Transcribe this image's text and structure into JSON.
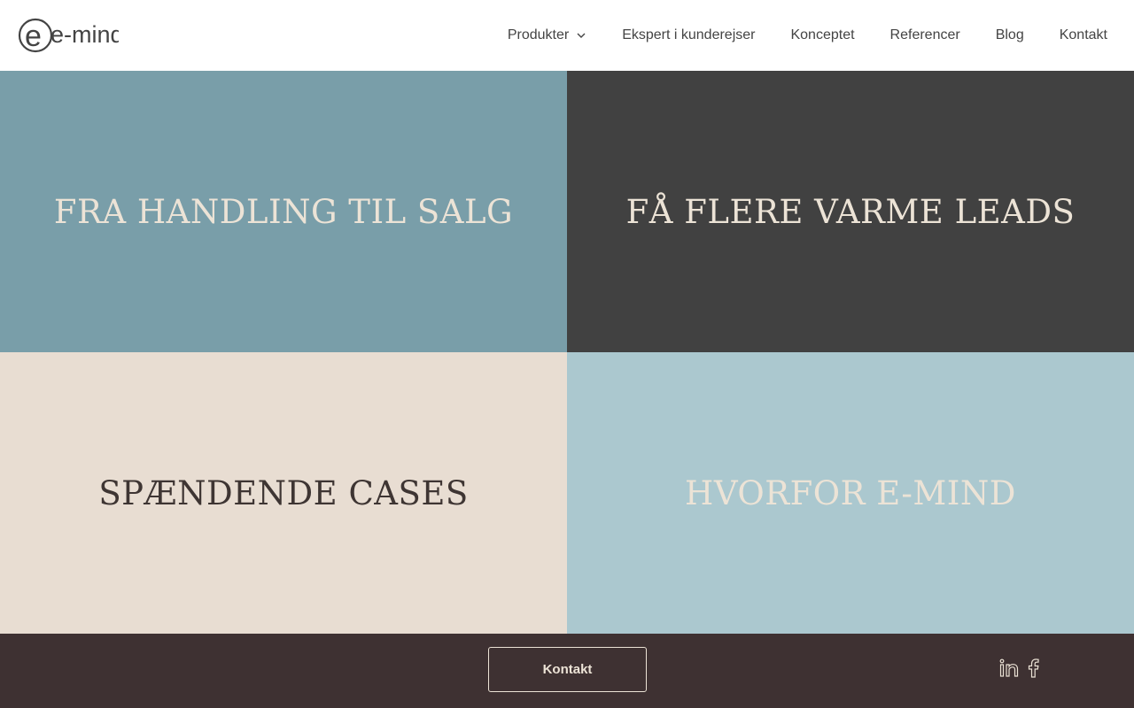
{
  "header": {
    "logo": {
      "text": "e-mind",
      "icon": "e-mind-logo"
    },
    "nav": [
      {
        "label": "Produkter",
        "has_dropdown": true
      },
      {
        "label": "Ekspert i kunderejser"
      },
      {
        "label": "Konceptet"
      },
      {
        "label": "Referencer"
      },
      {
        "label": "Blog"
      },
      {
        "label": "Kontakt"
      }
    ]
  },
  "tiles": [
    {
      "title": "FRA HANDLING TIL SALG",
      "bg": "#799ea9",
      "color": "#ece3d6"
    },
    {
      "title": "FÅ FLERE VARME LEADS",
      "bg": "#414141",
      "color": "#ece3d6"
    },
    {
      "title": "SPÆNDENDE CASES",
      "bg": "#e8ddd2",
      "color": "#3e3533"
    },
    {
      "title": "HVORFOR E-MIND",
      "bg": "#abc8cf",
      "color": "#ece3d6"
    }
  ],
  "footer": {
    "contact_label": "Kontakt",
    "bg": "#3e3132",
    "social": [
      {
        "icon": "linkedin-icon"
      },
      {
        "icon": "facebook-icon"
      }
    ]
  }
}
